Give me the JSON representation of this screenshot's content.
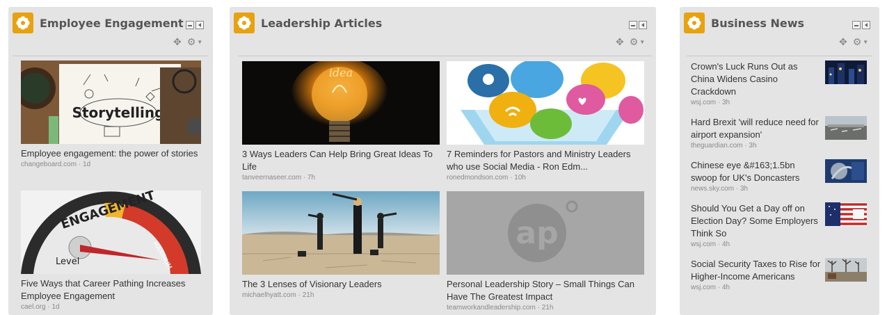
{
  "colors": {
    "panel_bg": "#e4e4e4",
    "logo_bg": "#e8a20f",
    "title_text": "#555555",
    "meta_text": "#8a8a8a"
  },
  "panels": [
    {
      "title": "Employee Engagement",
      "icons": [
        "flower-logo-icon",
        "minimize-icon",
        "collapse-icon",
        "move-icon",
        "gear-icon",
        "caret-down-icon"
      ],
      "items": [
        {
          "title": "Employee engagement: the power of stories",
          "source": "changeboard.com · 1d",
          "thumb": "storytelling"
        },
        {
          "title": "Five Ways that Career Pathing Increases Employee Engagement",
          "source": "cael.org · 1d",
          "thumb": "engagement-gauge"
        }
      ]
    },
    {
      "title": "Leadership Articles",
      "icons": [
        "flower-logo-icon",
        "minimize-icon",
        "collapse-icon",
        "move-icon",
        "gear-icon",
        "caret-down-icon"
      ],
      "items": [
        {
          "title": "3 Ways Leaders Can Help Bring Great Ideas To Life",
          "source": "tanveernaseer.com · 7h",
          "thumb": "lightbulb-idea"
        },
        {
          "title": "7 Reminders for Pastors and Ministry Leaders who use Social Media - Ron Edm...",
          "source": "ronedmondson.com · 10h",
          "thumb": "social-bubbles"
        },
        {
          "title": "The 3 Lenses of Visionary Leaders",
          "source": "michaelhyatt.com · 21h",
          "thumb": "telescopes-desert"
        },
        {
          "title": "Personal Leadership Story – Small Things Can Have The Greatest Impact",
          "source": "teamworkandleadership.com · 21h",
          "thumb": "ap-placeholder",
          "placeholder_text": "ap"
        }
      ]
    },
    {
      "title": "Business News",
      "icons": [
        "flower-logo-icon",
        "minimize-icon",
        "collapse-icon",
        "move-icon",
        "gear-icon",
        "caret-down-icon"
      ],
      "items": [
        {
          "title": "Crown's Luck Runs Out as China Widens Casino Crackdown",
          "source": "wsj.com · 3h",
          "thumb": "night-city"
        },
        {
          "title": "Hard Brexit 'will reduce need for airport expansion'",
          "source": "theguardian.com · 3h",
          "thumb": "airport"
        },
        {
          "title": "Chinese eye &#163;1.5bn swoop for UK's Doncasters",
          "source": "news.sky.com · 3h",
          "thumb": "factory-blue"
        },
        {
          "title": "Should You Get a Day off on Election Day? Some Employers Think So",
          "source": "wsj.com · 4h",
          "thumb": "flag-vote"
        },
        {
          "title": "Social Security Taxes to Rise for Higher-Income Americans",
          "source": "wsj.com · 4h",
          "thumb": "winter-park"
        }
      ]
    }
  ]
}
